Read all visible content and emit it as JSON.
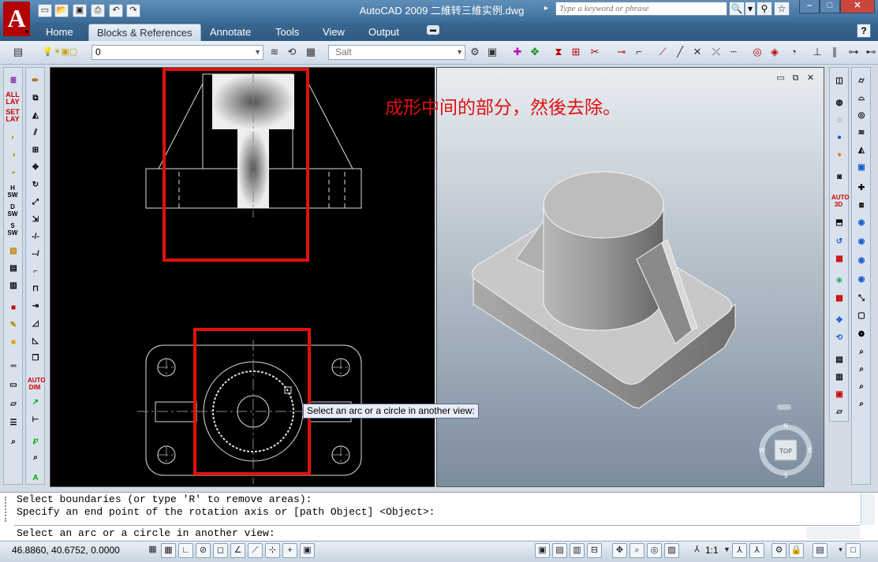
{
  "window": {
    "title": "AutoCAD 2009 二維转三維实例.dwg",
    "search_placeholder": "Type a keyword or phrase",
    "minimize": "–",
    "maximize": "□",
    "close": "✕"
  },
  "ribbon": {
    "tabs": [
      "Home",
      "Blocks & References",
      "Annotate",
      "Tools",
      "View",
      "Output"
    ],
    "active_tab": "Blocks & References",
    "help": "?"
  },
  "toolbar": {
    "layer_value": "0",
    "text_style_value": "Salt"
  },
  "sidebar_left": {
    "labels": [
      "ALL LAY",
      "SET LAY",
      "H SW",
      "D SW",
      "S SW"
    ],
    "auto_dim": "AUTO DIM"
  },
  "sidebar_right": {
    "auto3d": "AUTO 3D"
  },
  "viewport_left": {
    "annotation": "成形中间的部分，然後去除。",
    "tooltip": "Select an arc or a circle in another view:",
    "highlight_color": "#e01010"
  },
  "viewport_right": {
    "viewcube_face": "TOP",
    "compass": {
      "n": "N",
      "s": "S",
      "w": "W",
      "e": "E"
    },
    "bg_top": "#e8edf1",
    "bg_bottom": "#7b8c9d"
  },
  "command": {
    "history": [
      "Select boundaries (or type 'R' to remove areas):",
      "Specify an end point of the rotation axis or [path Object] <Object>:"
    ],
    "prompt": "Select an arc or a circle in another view:"
  },
  "status": {
    "coordinates": "46.8860, 40.6752, 0.0000",
    "annotation_scale": "1:1"
  }
}
